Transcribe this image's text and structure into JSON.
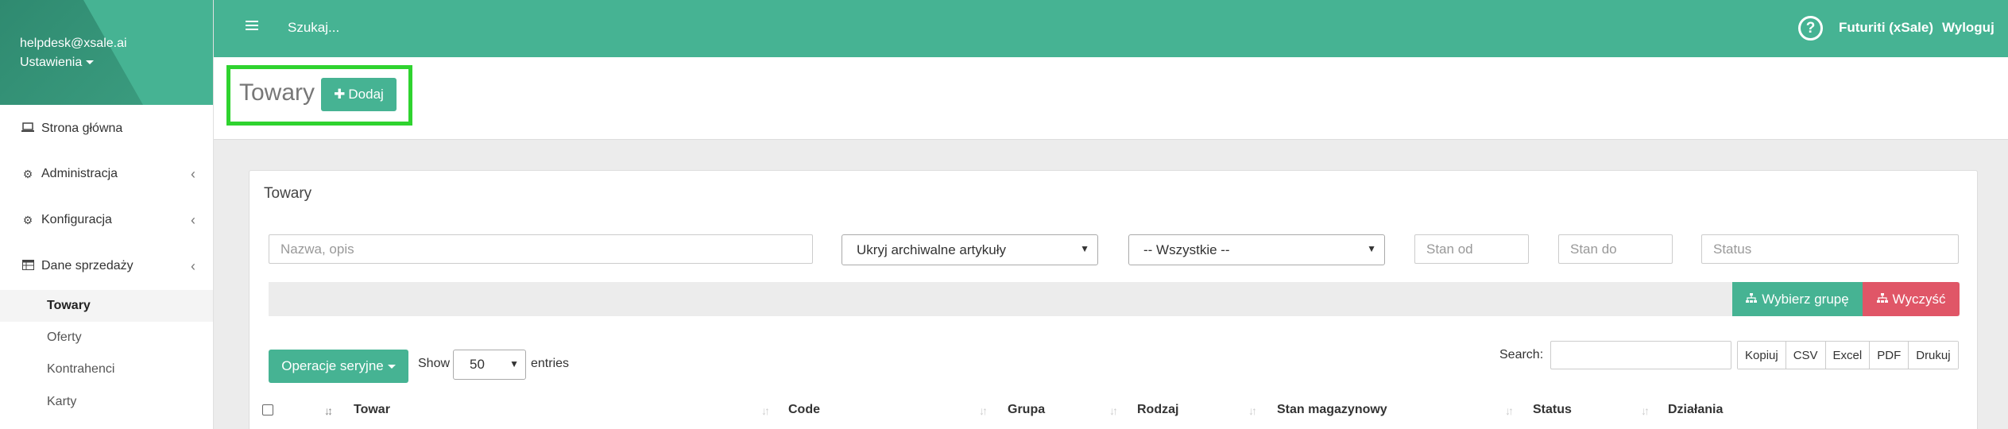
{
  "sidebar": {
    "email": "helpdesk@xsale.ai",
    "settings_label": "Ustawienia",
    "items": [
      {
        "label": "Strona główna",
        "icon": "laptop-icon"
      },
      {
        "label": "Administracja",
        "icon": "gear-icon"
      },
      {
        "label": "Konfiguracja",
        "icon": "gears-icon"
      },
      {
        "label": "Dane sprzedaży",
        "icon": "table-icon"
      }
    ],
    "subitems": [
      "Towary",
      "Oferty",
      "Kontrahenci",
      "Karty"
    ]
  },
  "topbar": {
    "search_placeholder": "Szukaj...",
    "company": "Futuriti (xSale)",
    "logout": "Wyloguj"
  },
  "header": {
    "title": "Towary",
    "add_label": "Dodaj"
  },
  "box": {
    "title": "Towary",
    "filters": {
      "name_placeholder": "Nazwa, opis",
      "archive_select": "Ukryj archiwalne artykuły",
      "all_select": "-- Wszystkie --",
      "stock_from_placeholder": "Stan od",
      "stock_to_placeholder": "Stan do",
      "status_placeholder": "Status"
    },
    "group_button": "Wybierz grupę",
    "clear_button": "Wyczyść",
    "ops_button": "Operacje seryjne",
    "show_label": "Show",
    "entries_value": "50",
    "entries_label": "entries",
    "search_label": "Search:",
    "export_buttons": [
      "Kopiuj",
      "CSV",
      "Excel",
      "PDF",
      "Drukuj"
    ],
    "columns": [
      "Towar",
      "Code",
      "Grupa",
      "Rodzaj",
      "Stan magazynowy",
      "Status",
      "Działania"
    ]
  },
  "colors": {
    "accent": "#46b393",
    "danger": "#e05667",
    "highlight": "#2fd32f"
  }
}
